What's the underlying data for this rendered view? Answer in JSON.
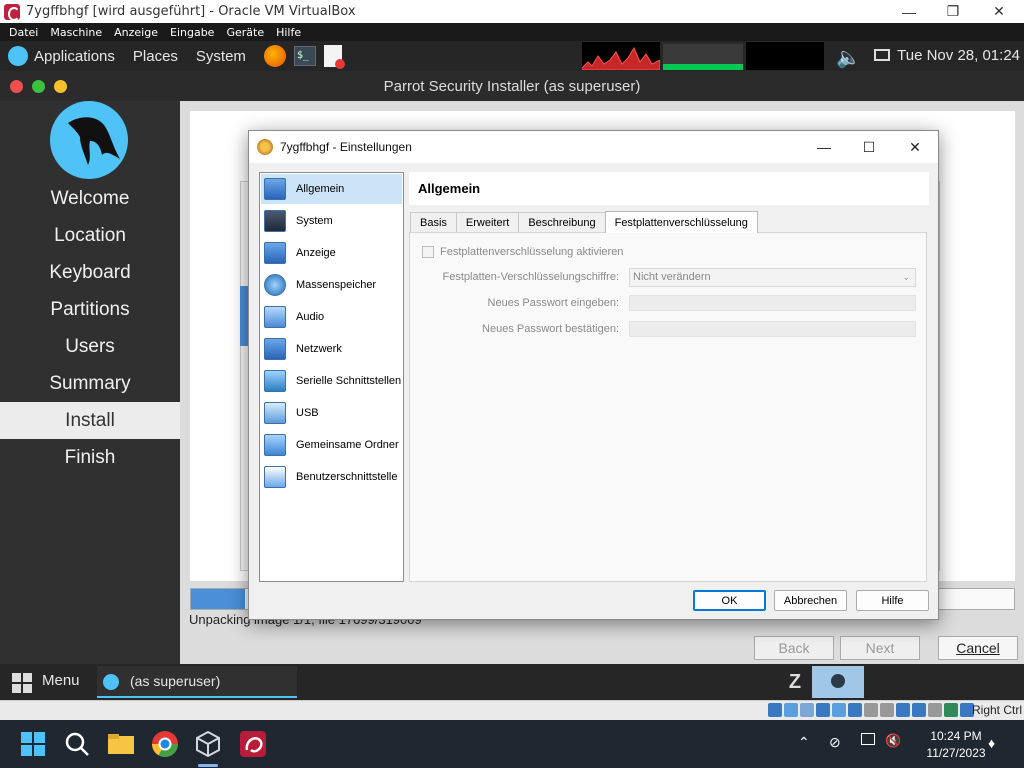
{
  "host_window": {
    "title": "7ygffbhgf [wird ausgeführt] - Oracle VM VirtualBox",
    "menu": [
      "Datei",
      "Maschine",
      "Anzeige",
      "Eingabe",
      "Geräte",
      "Hilfe"
    ]
  },
  "guest_panel": {
    "applications": "Applications",
    "places": "Places",
    "system": "System",
    "clock": "Tue Nov 28, 01:24"
  },
  "installer": {
    "title": "Parrot Security Installer (as superuser)",
    "steps": [
      "Welcome",
      "Location",
      "Keyboard",
      "Partitions",
      "Users",
      "Summary",
      "Install",
      "Finish"
    ],
    "active_step": "Install",
    "progress_text": "Unpacking image 1/1, file 17699/319009",
    "progress_fraction": 0.066,
    "back": "Back",
    "next": "Next",
    "cancel": "Cancel"
  },
  "guest_bottom": {
    "menu": "Menu",
    "task": "(as superuser)"
  },
  "vbox_status": {
    "host_key": "Right Ctrl"
  },
  "win_taskbar": {
    "time": "10:24 PM",
    "date": "11/27/2023"
  },
  "dialog": {
    "title": "7ygffbhgf - Einstellungen",
    "categories": [
      "Allgemein",
      "System",
      "Anzeige",
      "Massenspeicher",
      "Audio",
      "Netzwerk",
      "Serielle Schnittstellen",
      "USB",
      "Gemeinsame Ordner",
      "Benutzerschnittstelle"
    ],
    "selected_category": "Allgemein",
    "page_title": "Allgemein",
    "tabs": [
      "Basis",
      "Erweitert",
      "Beschreibung",
      "Festplattenverschlüsselung"
    ],
    "active_tab": "Festplattenverschlüsselung",
    "encryption": {
      "enable_label": "Festplattenverschlüsselung aktivieren",
      "enabled": false,
      "cipher_label": "Festplatten-Verschlüsselungschiffre:",
      "cipher_value": "Nicht verändern",
      "new_password_label": "Neues Passwort eingeben:",
      "confirm_password_label": "Neues Passwort bestätigen:"
    },
    "buttons": {
      "ok": "OK",
      "cancel": "Abbrechen",
      "help": "Hilfe"
    }
  },
  "colors": {
    "accent_blue": "#4fc3f7",
    "selection": "#cce4f7",
    "progress": "#4a90d9"
  }
}
